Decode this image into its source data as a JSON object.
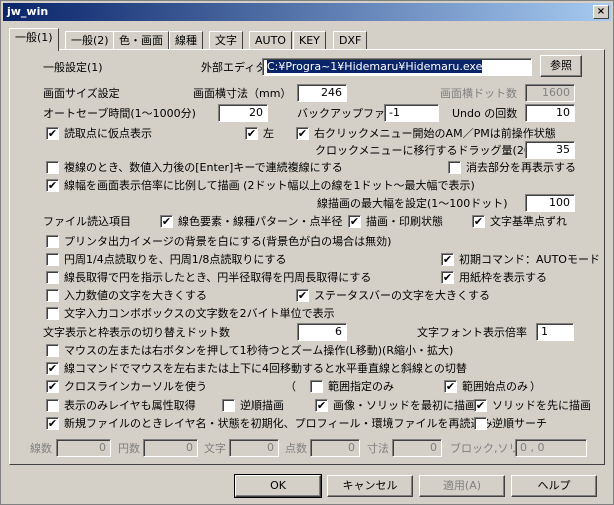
{
  "window": {
    "title": "jw_win",
    "close": "×"
  },
  "tabs": [
    "一般(1)",
    "一般(2)",
    "色・画面",
    "線種",
    "文字",
    "AUTO",
    "KEY",
    "DXF"
  ],
  "section_title": "一般設定(1)",
  "editor": {
    "label": "外部エディタ",
    "value": "C:¥Progra~1¥Hidemaru¥Hidemaru.exe",
    "browse": "参照"
  },
  "screen": {
    "label": "画面サイズ設定",
    "width_label": "画面横寸法（mm）",
    "width_value": "246",
    "dots_label": "画面横ドット数",
    "dots_value": "1600"
  },
  "autosave": {
    "label": "オートセーブ時間(1～1000分)",
    "value": "20",
    "backup_label": "バックアップファイル数",
    "backup_value": "-1",
    "undo_label": "Undo の回数",
    "undo_value": "10"
  },
  "readpoint": {
    "label": "読取点に仮点表示",
    "left_label": "左",
    "rightclick_label": "右クリックメニュー開始のAM／PMは前操作状態"
  },
  "drag": {
    "label": "クロックメニューに移行するドラッグ量(20～200)",
    "value": "35"
  },
  "checks": {
    "repeat_copy": "複線のとき、数値入力後の[Enter]キーで連続複線にする",
    "redisplay_erase": "消去部分を再表示する",
    "line_width_scale": "線幅を画面表示倍率に比例して描画 (2ドット幅以上の線を1ドット～最大幅で表示)",
    "printer_bg": "プリンタ出力イメージの背景を白にする(背景色が白の場合は無効)",
    "circle_quarter": "円周1/4点読取りを、円周1/8点読取りにする",
    "initial_command": "初期コマンド：AUTOモード",
    "line_length": "線長取得で円を指示したとき、円半径取得を円周長取得にする",
    "paper_frame": "用紙枠を表示する",
    "input_large": "入力数値の文字を大きくする",
    "statusbar_large": "ステータスバーの文字を大きくする",
    "combo_2byte": "文字入力コンボボックスの文字数を2バイト単位で表示",
    "mouse_zoom": "マウスの左または右ボタンを押して1秒待つとズーム操作(L移動)(R縮小・拡大)",
    "line_cmd": "線コマンドでマウスを左右または上下に4回移動すると水平垂直線と斜線との切替",
    "crossline": "クロスラインカーソルを使う",
    "range_only": "範囲指定のみ",
    "range_start": "範囲始点のみ",
    "layer_attr": "表示のみレイヤも属性取得",
    "reverse_draw": "逆順描画",
    "image_first": "画像・ソリッドを最初に描画",
    "solid_first": "ソリッドを先に描画",
    "new_file_init": "新規ファイルのときレイヤ名・状態を初期化、プロフィール・環境ファイルを再読込み",
    "reverse_search": "逆順サーチ"
  },
  "max_width": {
    "label": "線描画の最大幅を設定(1～100ドット)",
    "value": "100"
  },
  "file_read": {
    "label": "ファイル読込項目",
    "color": "線色要素・線種パターン・点半径",
    "draw_print": "描画・印刷状態",
    "text_align": "文字基準点ずれ"
  },
  "text_switch": {
    "label": "文字表示と枠表示の切り替えドット数",
    "value": "6",
    "font_label": "文字フォント表示倍率",
    "font_value": "1"
  },
  "paren_open": "（",
  "paren_close": "）",
  "counts": [
    {
      "label": "線数",
      "value": "0"
    },
    {
      "label": "円数",
      "value": "0"
    },
    {
      "label": "文字",
      "value": "0"
    },
    {
      "label": "点数",
      "value": "0"
    },
    {
      "label": "寸法",
      "value": "0"
    },
    {
      "label": "ブロック,ソリッド",
      "value": "0 , 0"
    }
  ],
  "buttons": {
    "ok": "OK",
    "cancel": "キャンセル",
    "apply": "適用(A)",
    "help": "ヘルプ"
  },
  "check_mark": "✔"
}
